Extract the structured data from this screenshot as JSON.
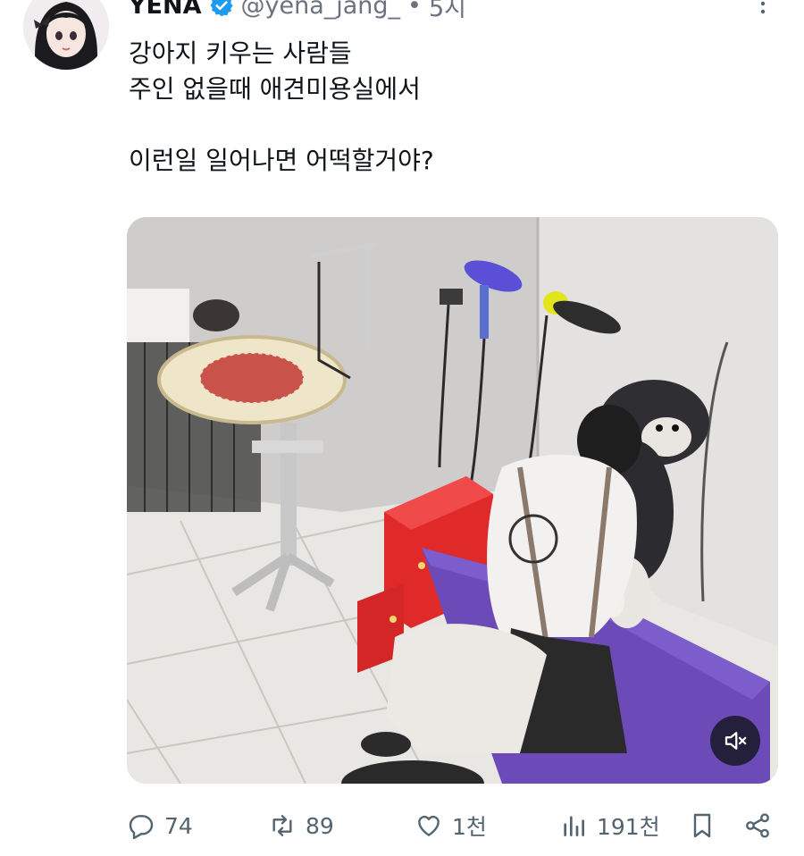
{
  "tweet": {
    "author_name": "YENA",
    "handle": "@yena_jang_",
    "separator": "•",
    "time": "5시",
    "lines": [
      "강아지 키우는 사람들",
      "주인 없을때 애견미용실에서",
      "",
      "이런일 일어나면 어떡할거야?"
    ]
  },
  "media": {
    "type": "video",
    "mute_icon": "volume-muted-icon"
  },
  "actions": {
    "replies": "74",
    "retweets": "89",
    "likes": "1천",
    "views": "191천"
  },
  "colors": {
    "text": "#0f1419",
    "secondary": "#536471",
    "verified": "#1d9bf0",
    "grooming_table": "#6c4bb8",
    "drawer_red": "#e02a2a"
  }
}
